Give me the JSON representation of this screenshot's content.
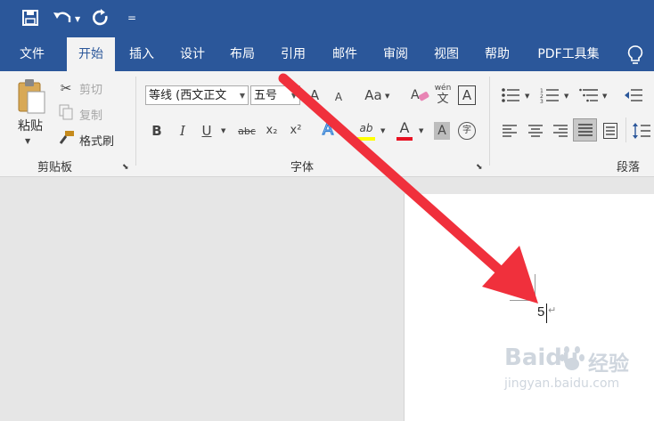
{
  "qat": {
    "more": "="
  },
  "tabs": [
    {
      "label": "文件"
    },
    {
      "label": "开始"
    },
    {
      "label": "插入"
    },
    {
      "label": "设计"
    },
    {
      "label": "布局"
    },
    {
      "label": "引用"
    },
    {
      "label": "邮件"
    },
    {
      "label": "审阅"
    },
    {
      "label": "视图"
    },
    {
      "label": "帮助"
    },
    {
      "label": "PDF工具集"
    }
  ],
  "clipboard": {
    "paste": "粘贴",
    "cut": "剪切",
    "copy": "复制",
    "format_painter": "格式刷",
    "group_label": "剪贴板"
  },
  "font": {
    "font_name": "等线 (西文正文",
    "font_size": "五号",
    "group_label": "字体",
    "bold": "B",
    "italic": "I",
    "underline": "U",
    "strike": "abc",
    "subscript": "x₂",
    "superscript": "x²",
    "grow": "A",
    "shrink": "A",
    "change_case": "Aa",
    "pinyin_top": "wén",
    "pinyin_bottom": "文",
    "border_char": "A",
    "effects": "A",
    "highlight": "ab",
    "color": "A",
    "shading": "A",
    "enclose": "字"
  },
  "paragraph": {
    "group_label": "段落"
  },
  "document": {
    "text": "5"
  },
  "watermark": {
    "brand": "Baidu",
    "brand_cn": "经验",
    "url": "jingyan.baidu.com"
  },
  "colors": {
    "accent": "#2b579a",
    "arrow": "#f0303c",
    "highlight": "#ffff00",
    "font_color": "#e81123"
  }
}
